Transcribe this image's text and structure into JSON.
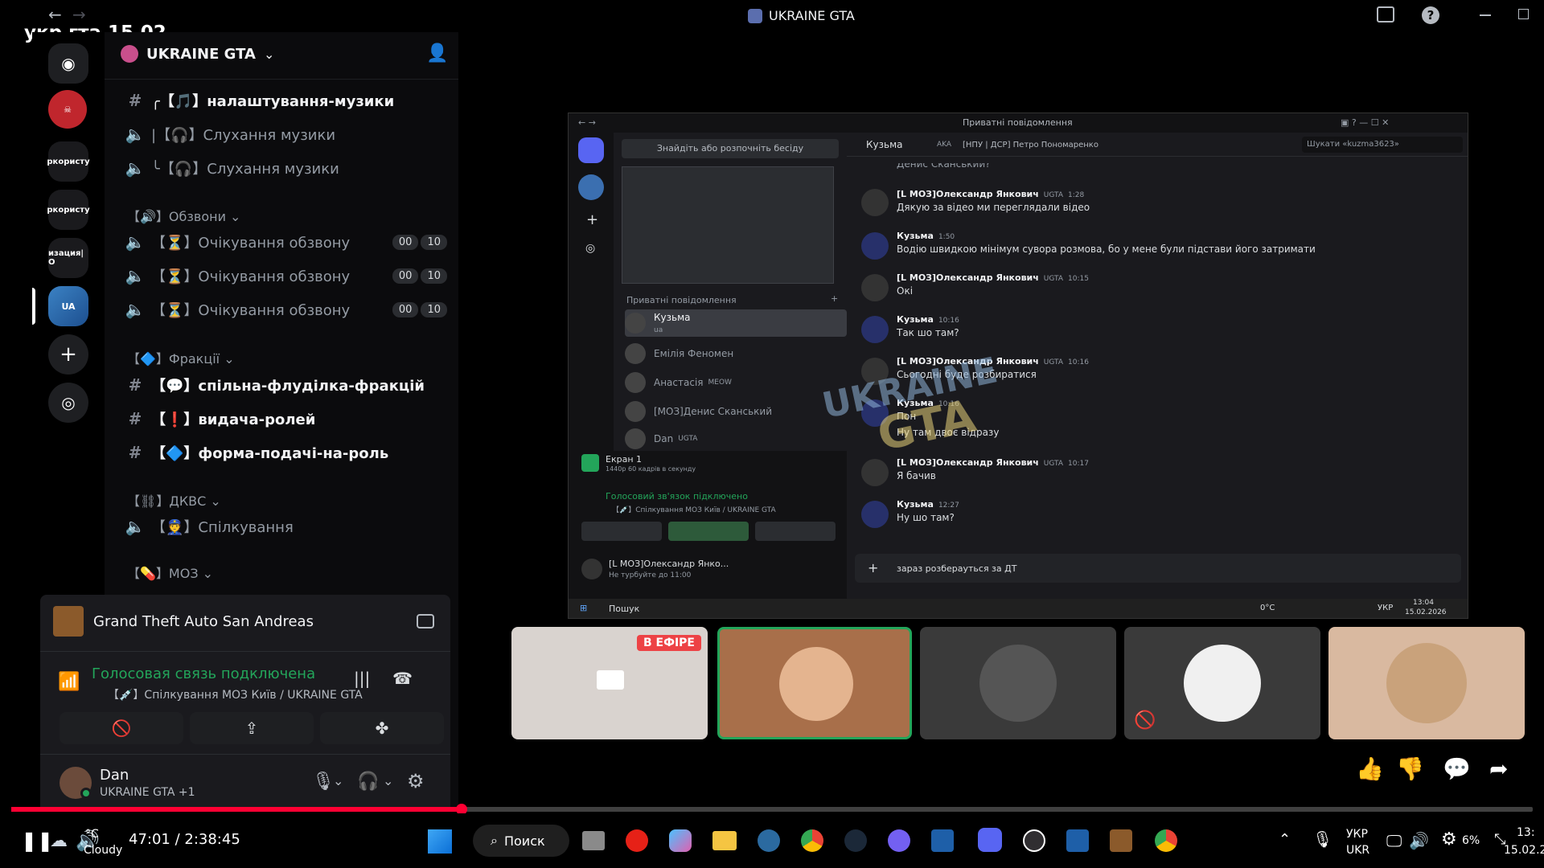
{
  "overlay_title": "укр гта 15.02",
  "window": {
    "title": "UKRAINE GTA"
  },
  "server": {
    "name": "UKRAINE GTA",
    "chevron": "⌄"
  },
  "server_labels": [
    "ркористу",
    "ркористу",
    "изация|О"
  ],
  "channels": [
    {
      "prefix": "#",
      "label": "╭【🎵】налаштування-музики",
      "type": "text",
      "bold": true
    },
    {
      "prefix": "🔈",
      "label": "|【🎧】Слухання музики",
      "type": "voice",
      "bold": false
    },
    {
      "prefix": "🔈",
      "label": "╰【🎧】Слухання музики",
      "type": "voice",
      "bold": false
    }
  ],
  "category_calls": {
    "label": "【🔊】Обзвони ⌄"
  },
  "waiting_channels": [
    {
      "label": "【⏳】Очікування обзвону",
      "c1": "00",
      "c2": "10"
    },
    {
      "label": "【⏳】Очікування обзвону",
      "c1": "00",
      "c2": "10"
    },
    {
      "label": "【⏳】Очікування обзвону",
      "c1": "00",
      "c2": "10"
    }
  ],
  "category_factions": {
    "label": "【🔷】Фракції ⌄"
  },
  "faction_channels": [
    {
      "label": "【💬】спільна-флуділка-фракцій"
    },
    {
      "label": "【❗】видача-ролей"
    },
    {
      "label": "【🔷】форма-подачі-на-роль"
    }
  ],
  "category_dkvs": {
    "label": "【⛓】ДКВС ⌄"
  },
  "dkvs_channel": {
    "label": "【👮】Спілкування"
  },
  "category_moz": {
    "label": "【💊】МОЗ ⌄"
  },
  "activity": {
    "game": "Grand Theft Auto San Andreas"
  },
  "voice": {
    "status": "Голосовая связь подключена",
    "channel": "【💉】Спілкування МОЗ Київ / UKRAINE GTA"
  },
  "user": {
    "name": "Dan",
    "status": "UKRAINE GTA +1"
  },
  "inner": {
    "title": "Приватні повідомлення",
    "search_placeholder": "Знайдіть або розпочніть бесіду",
    "dm_header": "Приватні повідомлення",
    "chat_user": "Кузьма",
    "aka_label": "AKA",
    "aka_value": "[НПУ | ДСР] Петро Пономаренко",
    "chat_search": "Шукати «kuzma3623»",
    "dms": [
      {
        "name": "Кузьма",
        "sub": "ua"
      },
      {
        "name": "Емілія Феномен",
        "sub": ""
      },
      {
        "name": "Анастасія",
        "sub": "MEOW"
      },
      {
        "name": "[МОЗ]Денис Сканський",
        "sub": ""
      },
      {
        "name": "Dan",
        "sub": "UGTA"
      }
    ],
    "screen_share": {
      "title": "Екран 1",
      "sub": "1440p 60 кадрів в секунду"
    },
    "voice_status": "Голосовий зв'язок підключено",
    "voice_channel": "【💉】Спілкування МОЗ Київ / UKRAINE GTA",
    "self_name": "[L МОЗ]Олександр Янко...",
    "self_status": "Не турбуйте до 11:00",
    "top_cut": "Денис Сканський?",
    "messages": [
      {
        "author": "[L МОЗ]Олександр Янкович",
        "tag": "UGTA",
        "time": "1:28",
        "lines": [
          "Дякую за відео ми переглядали відео"
        ]
      },
      {
        "author": "Кузьма",
        "tag": "",
        "time": "1:50",
        "lines": [
          "Водію швидкою мінімум сувора розмова, бо у мене були підстави його затримати"
        ]
      },
      {
        "author": "[L МОЗ]Олександр Янкович",
        "tag": "UGTA",
        "time": "10:15",
        "lines": [
          "Окі"
        ]
      },
      {
        "author": "Кузьма",
        "tag": "",
        "time": "10:16",
        "lines": [
          "Так шо там?"
        ]
      },
      {
        "author": "[L МОЗ]Олександр Янкович",
        "tag": "UGTA",
        "time": "10:16",
        "lines": [
          "Сьогодні буде розбиратися"
        ]
      },
      {
        "author": "Кузьма",
        "tag": "",
        "time": "10:16",
        "lines": [
          "Пон",
          "Ну там двоє відразу"
        ]
      },
      {
        "author": "[L МОЗ]Олександр Янкович",
        "tag": "UGTA",
        "time": "10:17",
        "lines": [
          "Я бачив"
        ]
      },
      {
        "author": "Кузьма",
        "tag": "",
        "time": "12:27",
        "lines": [
          "Ну шо там?"
        ]
      }
    ],
    "composer_text": "зараз розберауться за ДТ",
    "taskbar_search": "Пошук",
    "taskbar_lang": "УКР",
    "taskbar_time": "13:04",
    "taskbar_date": "15.02.2026",
    "taskbar_temp": "0°C",
    "watermark_top": "UKRAINE",
    "watermark_bottom": "GTA"
  },
  "live_badge": "В ЕФІРЕ",
  "player": {
    "time": "47:01 / 2:38:45",
    "progress": 0.296
  },
  "weather": {
    "temp": "°C",
    "desc": "Cloudy"
  },
  "taskbar": {
    "search": "Поиск",
    "lang1": "УКР",
    "lang2": "UKR",
    "battery": "6%",
    "clock": "13:",
    "date": "15.02.20"
  },
  "colors": {
    "accent": "#5865f2",
    "green": "#23a55a",
    "red": "#f23f43",
    "progress": "#ff0033"
  }
}
